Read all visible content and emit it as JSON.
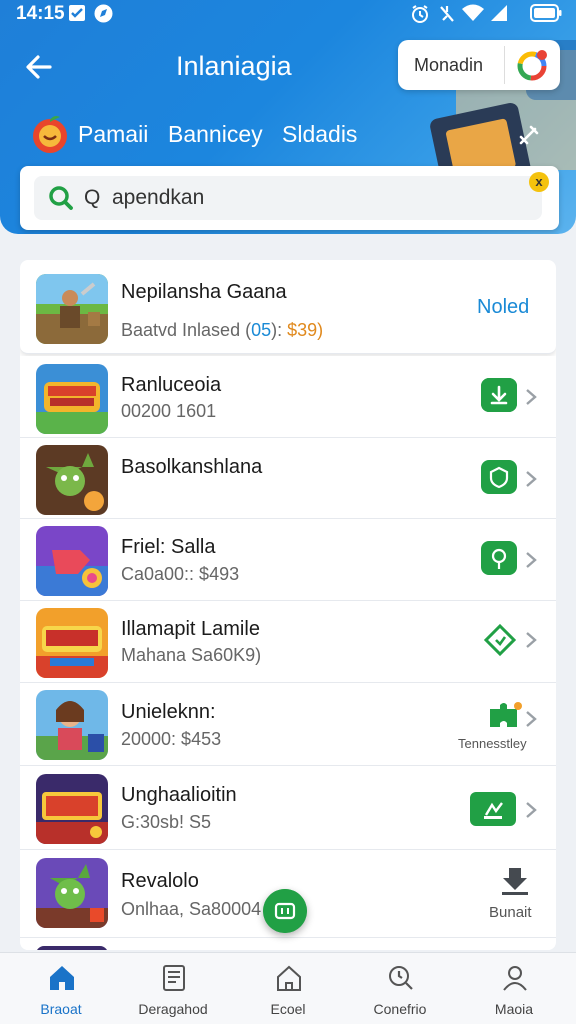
{
  "status_bar": {
    "time": "14:15"
  },
  "header": {
    "back_icon": "arrow-left-icon",
    "title": "Inlaniagia",
    "account": {
      "name": "Monadin",
      "logo_icon": "colorful-app-logo-icon"
    },
    "categories": [
      "Pamaii",
      "Bannicey",
      "Sldadis"
    ],
    "search": {
      "value": "Q  apendkan",
      "badge": "x"
    }
  },
  "list": {
    "items": [
      {
        "title": "Nepilansha Gaana",
        "sub_a": "Baatvd Inlased (",
        "sub_b": "05",
        "sub_c": "): ",
        "sub_d": "$39)",
        "status": "Noled"
      },
      {
        "title": "Ranluceoia",
        "subtitle": "00200 1601"
      },
      {
        "title": "Basolkanshlana",
        "subtitle": ""
      },
      {
        "title": "Friel: Salla",
        "subtitle": "Ca0a00:: $493"
      },
      {
        "title": "Illamapit Lamile",
        "subtitle": "Mahana Sa60K9)"
      },
      {
        "title": "Unieleknn:",
        "subtitle": "20000: $453",
        "badge_label": "Tennesstley"
      },
      {
        "title": "Unghaalioitin",
        "subtitle": "G:30sb! S5"
      },
      {
        "title": "Revalolo",
        "subtitle": "Onlhaa, Sa80004",
        "action_label": "Bunait"
      }
    ]
  },
  "bottom_nav": [
    {
      "label": "Braoat",
      "icon": "home-icon",
      "active": true
    },
    {
      "label": "Deragahod",
      "icon": "document-icon",
      "active": false
    },
    {
      "label": "Ecoel",
      "icon": "house-outline-icon",
      "active": false
    },
    {
      "label": "Conefrio",
      "icon": "search-clock-icon",
      "active": false
    },
    {
      "label": "Maoia",
      "icon": "profile-icon",
      "active": false
    }
  ],
  "colors": {
    "header_blue": "#1f7fd8",
    "accent_green": "#21a045",
    "link_blue": "#1a8ad6"
  }
}
